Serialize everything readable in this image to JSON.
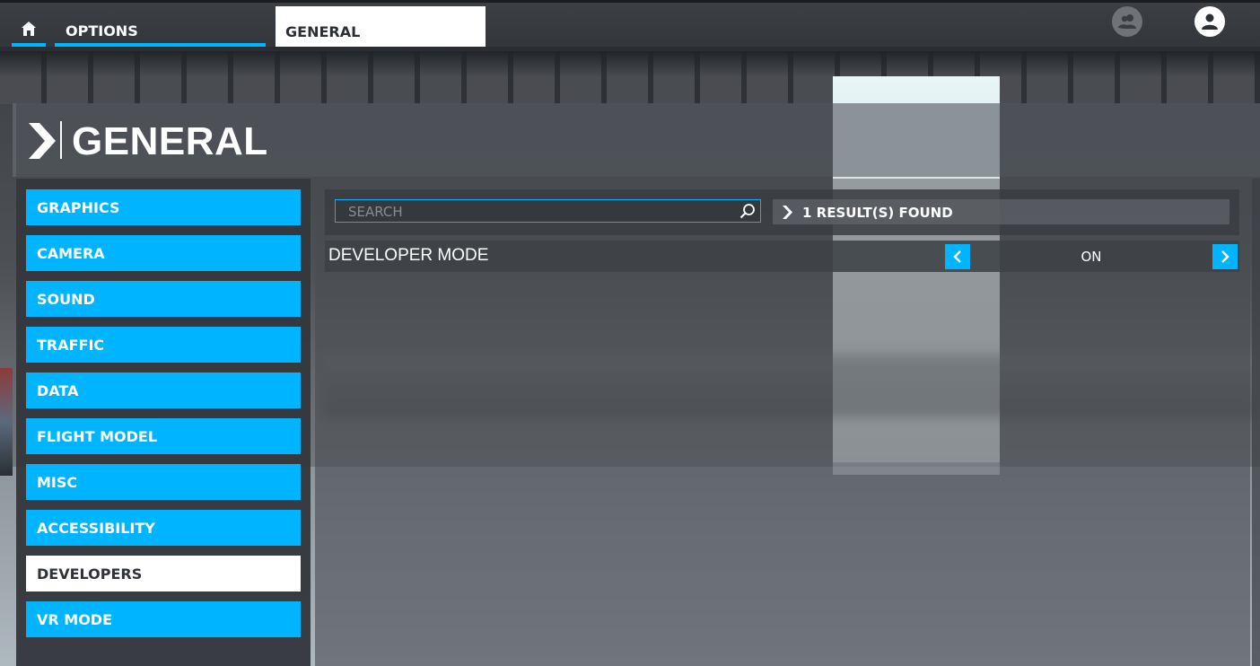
{
  "topbar": {
    "home_icon": "home-icon",
    "options_label": "OPTIONS",
    "general_tab_label": "GENERAL",
    "friends_icon": "friends-icon",
    "profile_icon": "profile-icon"
  },
  "page": {
    "title": "GENERAL",
    "title_icon": "chevron-right-icon"
  },
  "sidebar": {
    "items": [
      {
        "label": "GRAPHICS",
        "active": false
      },
      {
        "label": "CAMERA",
        "active": false
      },
      {
        "label": "SOUND",
        "active": false
      },
      {
        "label": "TRAFFIC",
        "active": false
      },
      {
        "label": "DATA",
        "active": false
      },
      {
        "label": "FLIGHT MODEL",
        "active": false
      },
      {
        "label": "MISC",
        "active": false
      },
      {
        "label": "ACCESSIBILITY",
        "active": false
      },
      {
        "label": "DEVELOPERS",
        "active": true
      },
      {
        "label": "VR MODE",
        "active": false
      }
    ]
  },
  "search": {
    "placeholder": "SEARCH",
    "icon": "search-icon",
    "results_text": "1 RESULT(S) FOUND"
  },
  "settings": [
    {
      "label": "DEVELOPER MODE",
      "value": "ON"
    }
  ],
  "colors": {
    "accent": "#00b4ff",
    "active_tab": "#ffffff",
    "panel": "#34373c"
  }
}
